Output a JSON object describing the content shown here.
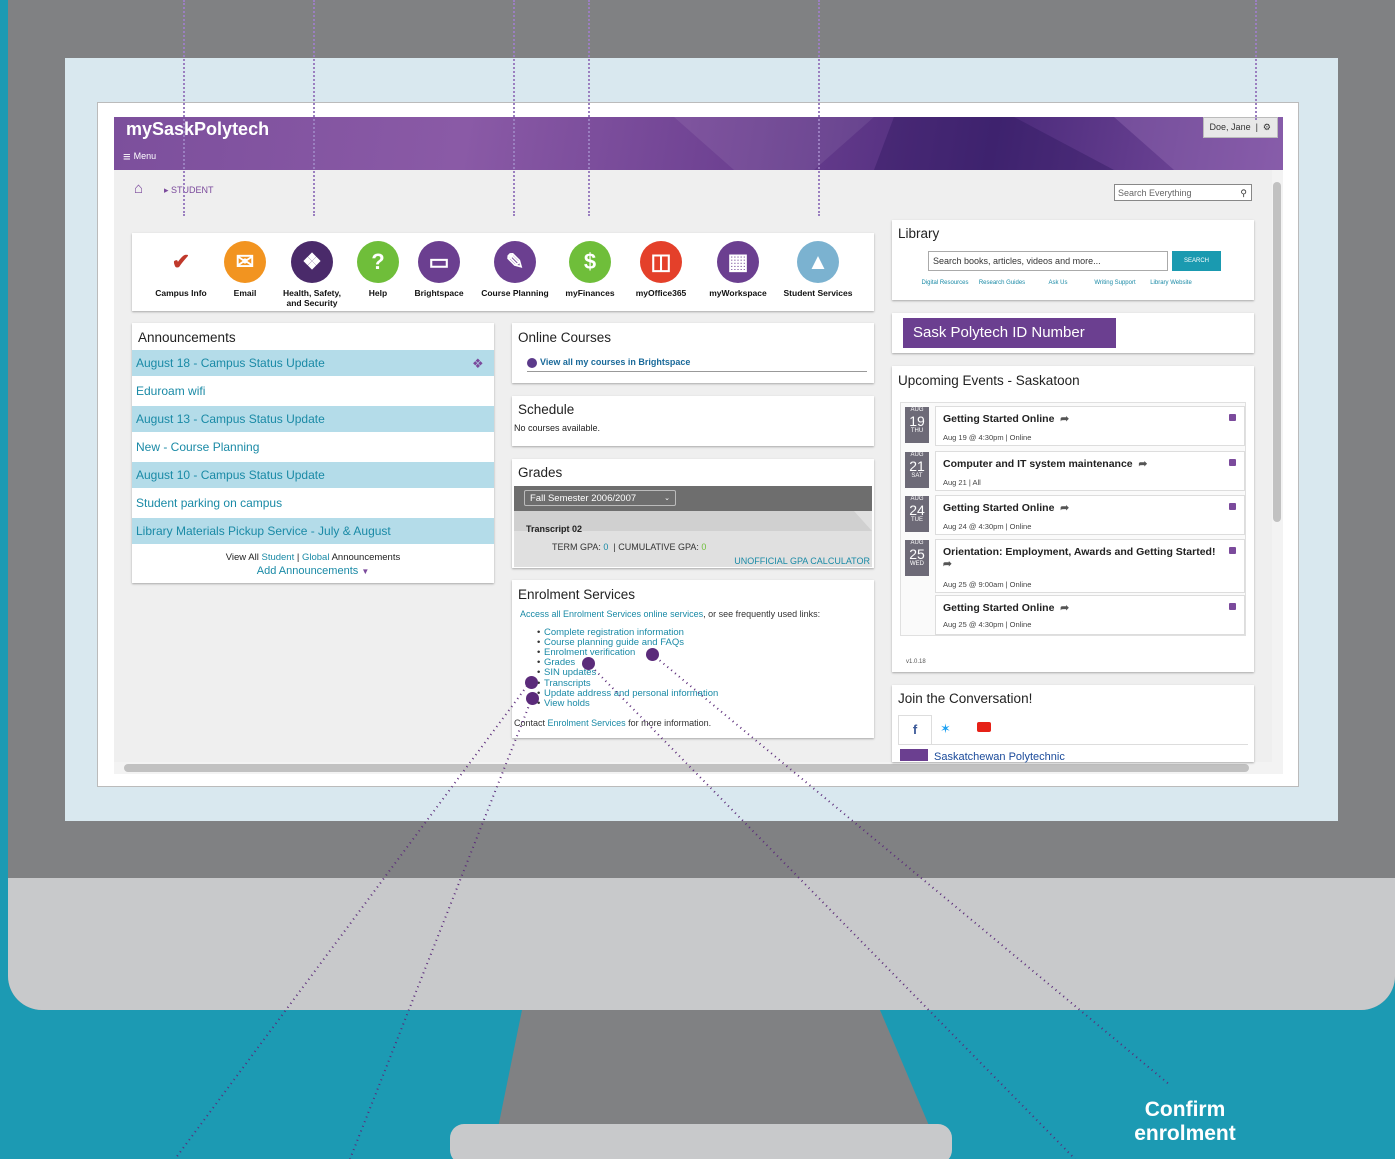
{
  "app": {
    "brand": "mySaskPolytech",
    "menu_label": "Menu",
    "user": "Doe, Jane",
    "breadcrumb": "STUDENT",
    "search_placeholder": "Search Everything"
  },
  "quick_links": [
    "Campus Info",
    "Email",
    "Health, Safety, and Security",
    "Help",
    "Brightspace",
    "Course Planning",
    "myFinances",
    "myOffice365",
    "myWorkspace",
    "Student Services"
  ],
  "announcements": {
    "title": "Announcements",
    "items": [
      "August 18 - Campus Status Update",
      "Eduroam wifi",
      "August 13 - Campus Status Update",
      "New - Course Planning",
      "August 10 - Campus Status Update",
      "Student parking on campus",
      "Library Materials Pickup Service - July & August"
    ],
    "view_all_prefix": "View All",
    "view_all_student": "Student",
    "view_all_sep": "|",
    "view_all_global": "Global",
    "view_all_suffix": "Announcements",
    "add": "Add Announcements"
  },
  "online_courses": {
    "title": "Online Courses",
    "link": "View all my courses in Brightspace"
  },
  "schedule": {
    "title": "Schedule",
    "text": "No courses available."
  },
  "grades": {
    "title": "Grades",
    "semester": "Fall Semester 2006/2007",
    "transcript": "Transcript 02",
    "term_gpa_label": "TERM GPA:",
    "term_gpa": "0",
    "cum_gpa_label": "CUMULATIVE GPA:",
    "cum_gpa": "0",
    "calc": "UNOFFICIAL GPA CALCULATOR"
  },
  "enrolment": {
    "title": "Enrolment Services",
    "intro_link": "Access all Enrolment Services online services",
    "intro_rest": ", or see frequently used links:",
    "links": [
      "Complete registration information",
      "Course planning guide and FAQs",
      "Enrolment verification",
      "Grades",
      "SIN updates",
      "Transcripts",
      "Update address and personal information",
      "View holds"
    ],
    "contact_prefix": "Contact",
    "contact_link": "Enrolment Services",
    "contact_suffix": "for more information."
  },
  "library": {
    "title": "Library",
    "placeholder": "Search books, articles, videos and more...",
    "search_button": "SEARCH",
    "sublinks": [
      "Digital Resources",
      "Research Guides",
      "Ask Us",
      "Writing Support",
      "Library Website"
    ]
  },
  "id_number": {
    "title": "Sask Polytech ID Number"
  },
  "events": {
    "title": "Upcoming Events - Saskatoon",
    "items": [
      {
        "month": "AUG",
        "day": "19",
        "dow": "THU",
        "title": "Getting Started Online",
        "meta": "Aug 19 @ 4:30pm | Online"
      },
      {
        "month": "AUG",
        "day": "21",
        "dow": "SAT",
        "title": "Computer and IT system maintenance",
        "meta": "Aug 21 | All"
      },
      {
        "month": "AUG",
        "day": "24",
        "dow": "TUE",
        "title": "Getting Started Online",
        "meta": "Aug 24 @ 4:30pm | Online"
      },
      {
        "month": "AUG",
        "day": "25",
        "dow": "WED",
        "title": "Orientation: Employment, Awards and Getting Started!",
        "meta": "Aug 25 @ 9:00am | Online"
      },
      {
        "month": "",
        "day": "",
        "dow": "",
        "title": "Getting Started Online",
        "meta": "Aug 25 @ 4:30pm | Online"
      }
    ],
    "version": "v1.0.18"
  },
  "conversation": {
    "title": "Join the Conversation!",
    "account": "Saskatchewan Polytechnic"
  },
  "callout": {
    "line1": "Confirm",
    "line2": "enrolment"
  },
  "colors": {
    "purple": "#7b4a9c",
    "teal": "#1a8aa6",
    "background": "#1c9ab3"
  }
}
